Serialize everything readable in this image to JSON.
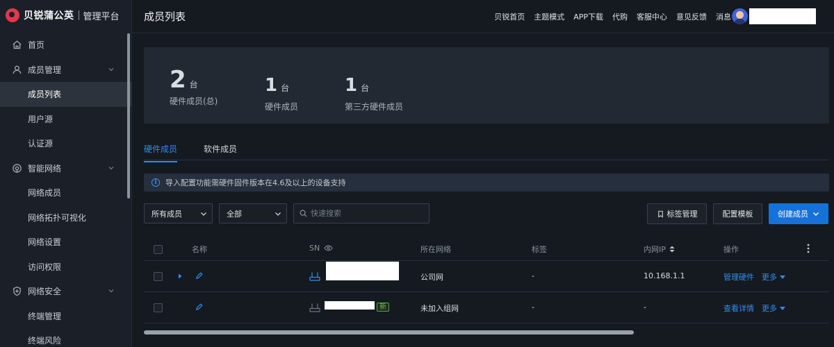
{
  "brand": {
    "name": "贝锐蒲公英",
    "subtitle": "管理平台"
  },
  "sidebar": {
    "items": [
      {
        "label": "首页",
        "icon": "home-icon"
      },
      {
        "label": "成员管理",
        "icon": "user-icon"
      },
      {
        "label": "成员列表"
      },
      {
        "label": "用户源"
      },
      {
        "label": "认证源"
      },
      {
        "label": "智能网络",
        "icon": "network-icon"
      },
      {
        "label": "网络成员"
      },
      {
        "label": "网络拓扑可视化"
      },
      {
        "label": "网络设置"
      },
      {
        "label": "访问权限"
      },
      {
        "label": "网络安全",
        "icon": "shield-icon"
      },
      {
        "label": "终端管理"
      },
      {
        "label": "终端风险"
      }
    ]
  },
  "header": {
    "title": "成员列表",
    "links": [
      "贝锐首页",
      "主题模式",
      "APP下载",
      "代购",
      "客服中心",
      "意见反馈",
      "消息"
    ]
  },
  "stats": [
    {
      "value": "2",
      "unit": "台",
      "label": "硬件成员(总)"
    },
    {
      "value": "1",
      "unit": "台",
      "label": "硬件成员"
    },
    {
      "value": "1",
      "unit": "台",
      "label": "第三方硬件成员"
    }
  ],
  "tabs": [
    "硬件成员",
    "软件成员"
  ],
  "notice": "导入配置功能需硬件固件版本在4.6及以上的设备支持",
  "filters": {
    "member_select": "所有成员",
    "status_select": "全部",
    "search_placeholder": "快速搜索"
  },
  "actions": {
    "tag_manage": "标签管理",
    "config_template": "配置模板",
    "create_member": "创建成员"
  },
  "table": {
    "headers": {
      "name": "名称",
      "sn": "SN",
      "network": "所在网络",
      "tag": "标签",
      "lan_ip": "内网IP",
      "ops": "操作"
    },
    "rows": [
      {
        "network": "公司网",
        "tag": "-",
        "lan_ip": "10.168.1.1",
        "action": "管理硬件",
        "more": "更多"
      },
      {
        "network": "未加入组网",
        "tag": "-",
        "lan_ip": "-",
        "action": "查看详情",
        "more": "更多",
        "badge": "新"
      }
    ]
  },
  "colors": {
    "accent": "#1672d9",
    "link": "#2e8ff0",
    "brand": "#e8344e",
    "new_badge": "#4fae3b"
  }
}
